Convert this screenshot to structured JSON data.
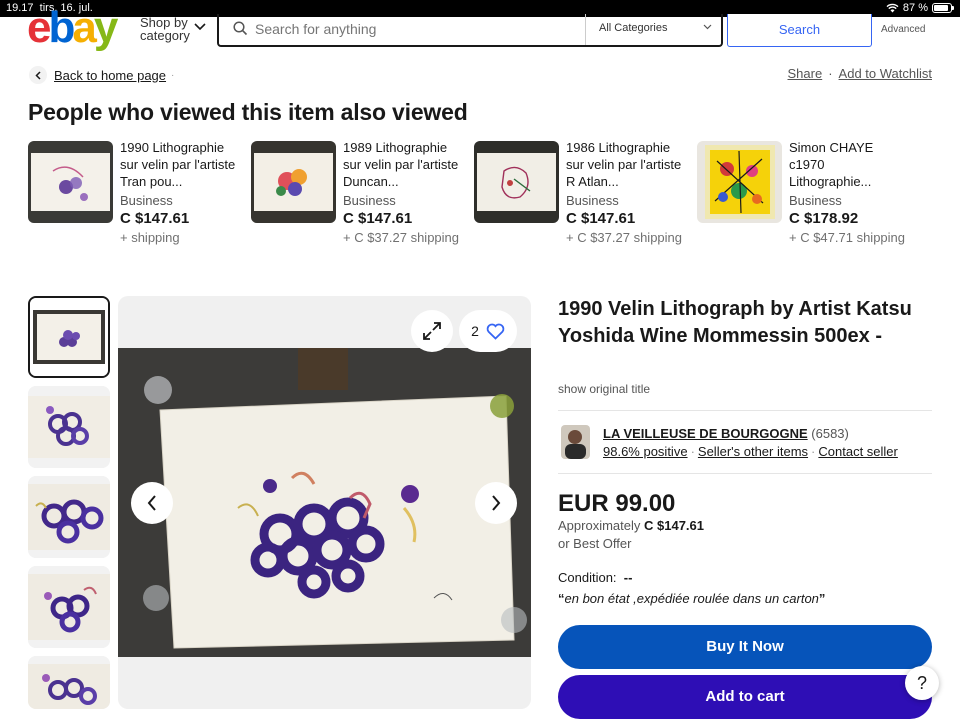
{
  "status_bar": {
    "time": "19.17",
    "date": "tirs. 16. jul.",
    "battery": "87 %"
  },
  "header": {
    "logo": [
      "e",
      "b",
      "a",
      "y"
    ],
    "shop_by_line1": "Shop by",
    "shop_by_line2": "category",
    "search_placeholder": "Search for anything",
    "category": "All Categories",
    "search_button": "Search",
    "advanced": "Advanced"
  },
  "nav": {
    "back": "Back to home page",
    "share": "Share",
    "watchlist": "Add to Watchlist",
    "separator": "·"
  },
  "also_viewed": {
    "heading": "People who viewed this item also viewed",
    "items": [
      {
        "title": "1990 Lithographie sur velin par l'artiste Tran pou...",
        "condition": "Business",
        "price": "C $147.61",
        "shipping": "+ shipping",
        "icon": "purple-sketch-lithograph-thumbnail"
      },
      {
        "title": "1989 Lithographie sur velin par l'artiste Duncan...",
        "condition": "Business",
        "price": "C $147.61",
        "shipping": "+ C $37.27 shipping",
        "icon": "floral-lithograph-thumbnail"
      },
      {
        "title": "1986 Lithographie sur velin par l'artiste R Atlan...",
        "condition": "Business",
        "price": "C $147.61",
        "shipping": "+ C $37.27 shipping",
        "icon": "figure-lithograph-thumbnail"
      },
      {
        "title": "Simon CHAYE c1970 Lithographie...",
        "condition": "Business",
        "price": "C $178.92",
        "shipping": "+ C $47.71 shipping",
        "icon": "yellow-flower-lithograph-thumbnail"
      }
    ]
  },
  "gallery": {
    "watch_count": "2"
  },
  "listing": {
    "title": "1990 Velin Lithograph by Artist Katsu Yoshida Wine Mommessin 500ex -",
    "show_original": "show original title",
    "seller_name": "LA VEILLEUSE DE BOURGOGNE",
    "seller_count": "(6583)",
    "positive": "98.6% positive",
    "other_items": "Seller's other items",
    "contact": "Contact seller",
    "price": "EUR 99.00",
    "approx_label": "Approximately",
    "approx_value": "C $147.61",
    "best_offer": "or Best Offer",
    "condition_label": "Condition:",
    "condition_value": "--",
    "condition_note": "en bon état ,expédiée roulée dans un carton",
    "buy_now": "Buy It Now",
    "add_to_cart": "Add to cart",
    "help": "?"
  },
  "colors": {
    "buy_now": "#0654ba",
    "add_to_cart": "#2e0eb5",
    "link": "#3665f3"
  }
}
